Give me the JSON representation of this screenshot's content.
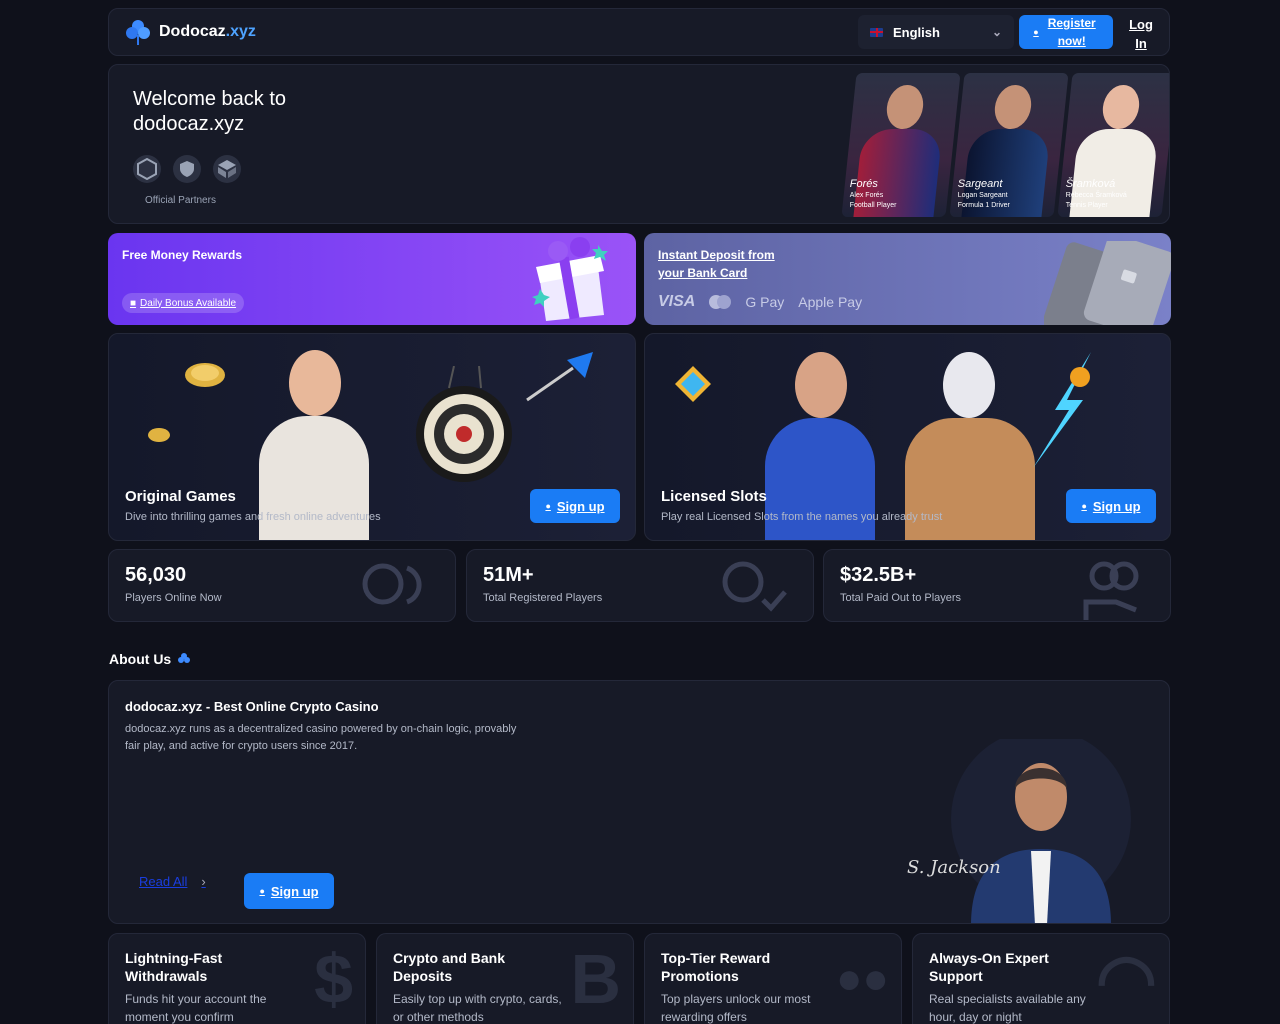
{
  "header": {
    "logo_name": "Dodocaz",
    "logo_tld": ".xyz",
    "language": "English",
    "register_label": "Register now!",
    "login_label": "Log In"
  },
  "hero": {
    "title": "Welcome back to dodocaz.xyz",
    "partners_label": "Official Partners",
    "partners": [
      "crypto.com",
      "TRUST",
      "blockchain"
    ],
    "athletes": [
      {
        "signature": "Forés",
        "name": "Alex Forés",
        "role": "Football Player"
      },
      {
        "signature": "Sargeant",
        "name": "Logan Sargeant",
        "role": "Formula 1 Driver"
      },
      {
        "signature": "Šramková",
        "name": "Rebecca Šramková",
        "role": "Tennis Player"
      }
    ]
  },
  "promos": {
    "rewards_title": "Free Money Rewards",
    "rewards_badge": "Daily Bonus Available",
    "deposit_title": "Instant Deposit from your Bank Card",
    "payment_methods": [
      "VISA",
      "Mastercard",
      "G Pay",
      "Apple Pay"
    ]
  },
  "tiles": [
    {
      "title": "Original Games",
      "subtitle": "Dive into thrilling games and fresh online adventures",
      "cta": "Sign up"
    },
    {
      "title": "Licensed Slots",
      "subtitle": "Play real Licensed Slots from the names you already trust",
      "cta": "Sign up"
    }
  ],
  "stats": [
    {
      "value": "56,030",
      "label": "Players Online Now"
    },
    {
      "value": "51M+",
      "label": "Total Registered Players"
    },
    {
      "value": "$32.5B+",
      "label": "Total Paid Out to Players"
    }
  ],
  "about": {
    "heading": "About Us",
    "title": "dodocaz.xyz - Best Online Crypto Casino",
    "text": "dodocaz.xyz runs as a decentralized casino powered by on-chain logic, provably fair play, and active for crypto users since 2017.",
    "read_all": "Read All",
    "cta": "Sign up",
    "signature": "S. Jackson"
  },
  "features": [
    {
      "title": "Lightning-Fast Withdrawals",
      "text": "Funds hit your account the moment you confirm",
      "icon": "$"
    },
    {
      "title": "Crypto and Bank Deposits",
      "text": "Easily top up with crypto, cards, or other methods",
      "icon": "B"
    },
    {
      "title": "Top-Tier Reward Promotions",
      "text": "Top players unlock our most rewarding offers",
      "icon": "●●"
    },
    {
      "title": "Always-On Expert Support",
      "text": "Real specialists available any hour, day or night",
      "icon": "◠"
    }
  ],
  "colors": {
    "accent": "#1a7cf5",
    "background": "#0f111b",
    "card": "#171a27",
    "purple": "#7c3ff3"
  }
}
